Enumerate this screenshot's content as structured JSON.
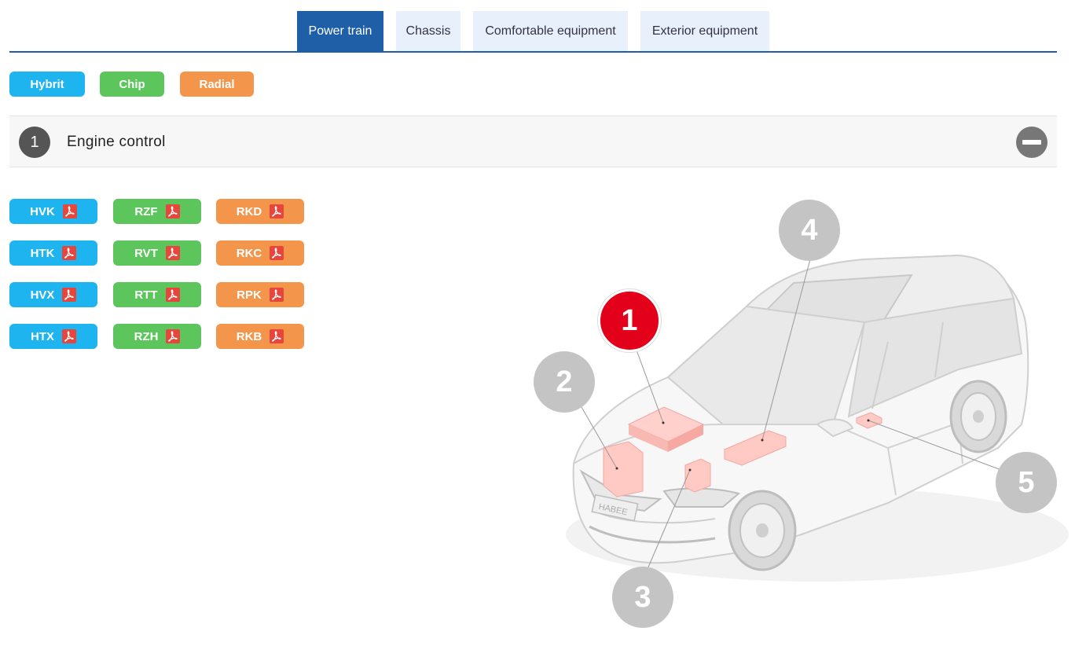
{
  "tabs": [
    {
      "label": "Power train",
      "active": true
    },
    {
      "label": "Chassis",
      "active": false
    },
    {
      "label": "Comfortable equipment",
      "active": false
    },
    {
      "label": "Exterior equipment",
      "active": false
    }
  ],
  "categories": [
    {
      "label": "Hybrit",
      "color": "#1eb4f0"
    },
    {
      "label": "Chip",
      "color": "#5cc65c"
    },
    {
      "label": "Radial",
      "color": "#f3954b"
    }
  ],
  "section": {
    "number": "1",
    "title": "Engine control"
  },
  "products": {
    "hybrit": [
      "HVK",
      "HTK",
      "HVX",
      "HTX"
    ],
    "chip": [
      "RZF",
      "RVT",
      "RTT",
      "RZH"
    ],
    "radial": [
      "RKD",
      "RKC",
      "RPK",
      "RKB"
    ]
  },
  "pdf_icon": "pdf-icon",
  "car": {
    "plate": "HABEE",
    "markers": [
      "1",
      "2",
      "3",
      "4",
      "5"
    ],
    "active_marker": "1"
  }
}
